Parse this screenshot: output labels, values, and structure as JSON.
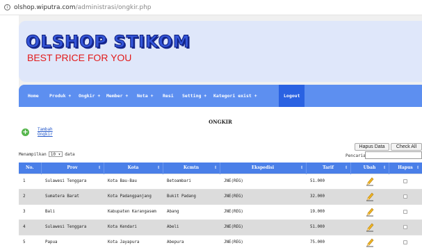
{
  "browser": {
    "url_host": "olshop.wiputra.com",
    "url_path": "/administrasi/ongkir.php"
  },
  "header": {
    "logo_title": "OLSHOP STIKOM",
    "logo_tagline": "BEST PRICE FOR YOU"
  },
  "nav": [
    {
      "label": "Home"
    },
    {
      "label": "Produk +"
    },
    {
      "label": "Ongkir +"
    },
    {
      "label": "Member +"
    },
    {
      "label": "Nota +"
    },
    {
      "label": "Resi"
    },
    {
      "label": "Setting +"
    },
    {
      "label": "Kategori exist +"
    },
    {
      "label": "Logout"
    }
  ],
  "page": {
    "title": "ONGKIR",
    "add_link_line1": "Tambah",
    "add_link_line2": "Ongkir",
    "show_prefix": "Menampilkan",
    "show_value": "10",
    "show_suffix": "data",
    "delete_button": "Hapus Data",
    "check_all_button": "Check All",
    "search_label": "Pencarian:",
    "search_value": ""
  },
  "table": {
    "columns": [
      "No.",
      "Prov",
      "Kota",
      "Kcmtn",
      "Ekspedisi",
      "Tarif",
      "Ubah",
      "Hapus"
    ],
    "rows": [
      {
        "no": "1",
        "prov": "Sulawesi Tenggara",
        "kota": "Kota Bau-Bau",
        "kcmtn": "Betoambari",
        "ekspedisi": "JNE(REG)",
        "tarif": "51.000"
      },
      {
        "no": "2",
        "prov": "Sumatera Barat",
        "kota": "Kota Padangpanjang",
        "kcmtn": "Bukit Padang",
        "ekspedisi": "JNE(REG)",
        "tarif": "32.000"
      },
      {
        "no": "3",
        "prov": "Bali",
        "kota": "Kabupaten Karangasem",
        "kcmtn": "Abang",
        "ekspedisi": "JNE(REG)",
        "tarif": "19.000"
      },
      {
        "no": "4",
        "prov": "Sulawesi Tenggara",
        "kota": "Kota Kendari",
        "kcmtn": "Abeli",
        "ekspedisi": "JNE(REG)",
        "tarif": "51.000"
      },
      {
        "no": "5",
        "prov": "Papua",
        "kota": "Kota Jayapura",
        "kcmtn": "Abepura",
        "ekspedisi": "JNE(REG)",
        "tarif": "75.000"
      }
    ]
  },
  "icons": {
    "add": "plus-circle-icon",
    "edit": "pencil-icon",
    "sort": "sort-arrows-icon",
    "info": "info-icon"
  },
  "colors": {
    "nav_bg": "#5d8ff0",
    "nav_active": "#2a62e2",
    "table_header": "#4a7fe8",
    "logo_blue": "#3455d8",
    "tagline_red": "#e21b1b",
    "add_green": "#56b64c"
  }
}
